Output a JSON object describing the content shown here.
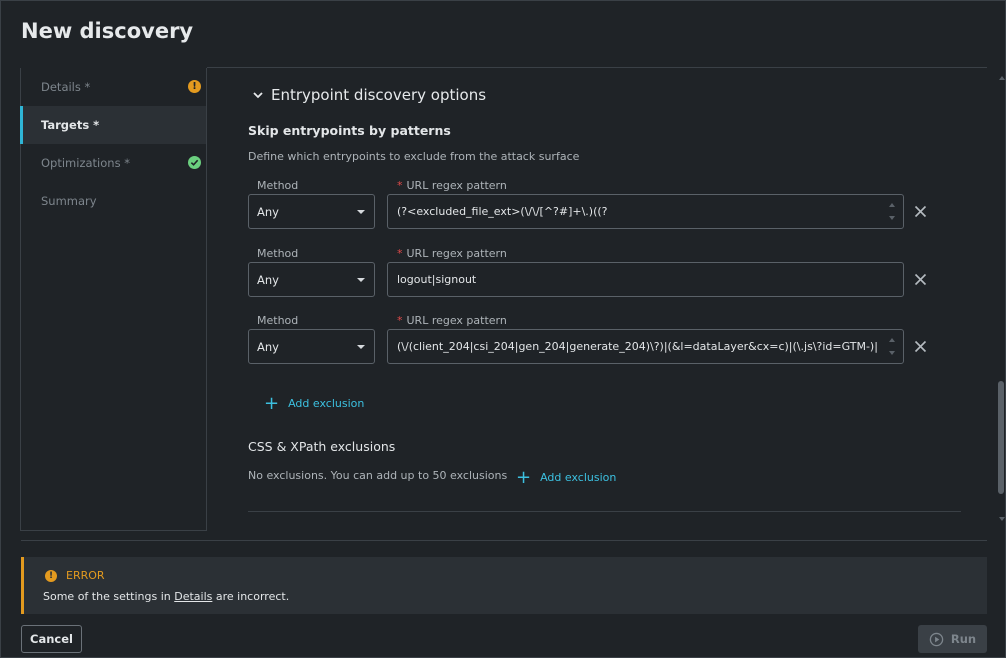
{
  "dialog": {
    "title": "New discovery"
  },
  "sidebar": {
    "items": [
      {
        "label": "Details *",
        "status": "warning"
      },
      {
        "label": "Targets *",
        "status": "active"
      },
      {
        "label": "Optimizations *",
        "status": "ok"
      },
      {
        "label": "Summary",
        "status": "none"
      }
    ]
  },
  "section": {
    "title": "Entrypoint discovery options",
    "skip_title": "Skip entrypoints by patterns",
    "skip_desc": "Define which entrypoints to exclude from the attack surface",
    "method_label": "Method",
    "url_label": "URL regex pattern",
    "required_mark": "*",
    "rows": [
      {
        "method": "Any",
        "pattern": "(?<excluded_file_ext>(\\/\\/[^?#]+\\.)((?"
      },
      {
        "method": "Any",
        "pattern": "logout|signout"
      },
      {
        "method": "Any",
        "pattern": "(\\/(client_204|csi_204|gen_204|generate_204)\\?)|(&l=dataLayer&cx=c)|(\\.js\\?id=GTM-)|"
      }
    ],
    "add_exclusion": "Add exclusion",
    "css_title": "CSS & XPath exclusions",
    "css_desc": "No exclusions. You can add up to 50 exclusions",
    "css_add": "Add exclusion"
  },
  "error": {
    "heading": "ERROR",
    "msg_before": "Some of the settings in ",
    "msg_link": "Details",
    "msg_after": " are incorrect."
  },
  "footer": {
    "cancel": "Cancel",
    "run": "Run"
  },
  "colors": {
    "accent": "#2fb5d6",
    "warning": "#e39a1f",
    "success": "#6bcf7f",
    "required": "#e04a4a"
  }
}
